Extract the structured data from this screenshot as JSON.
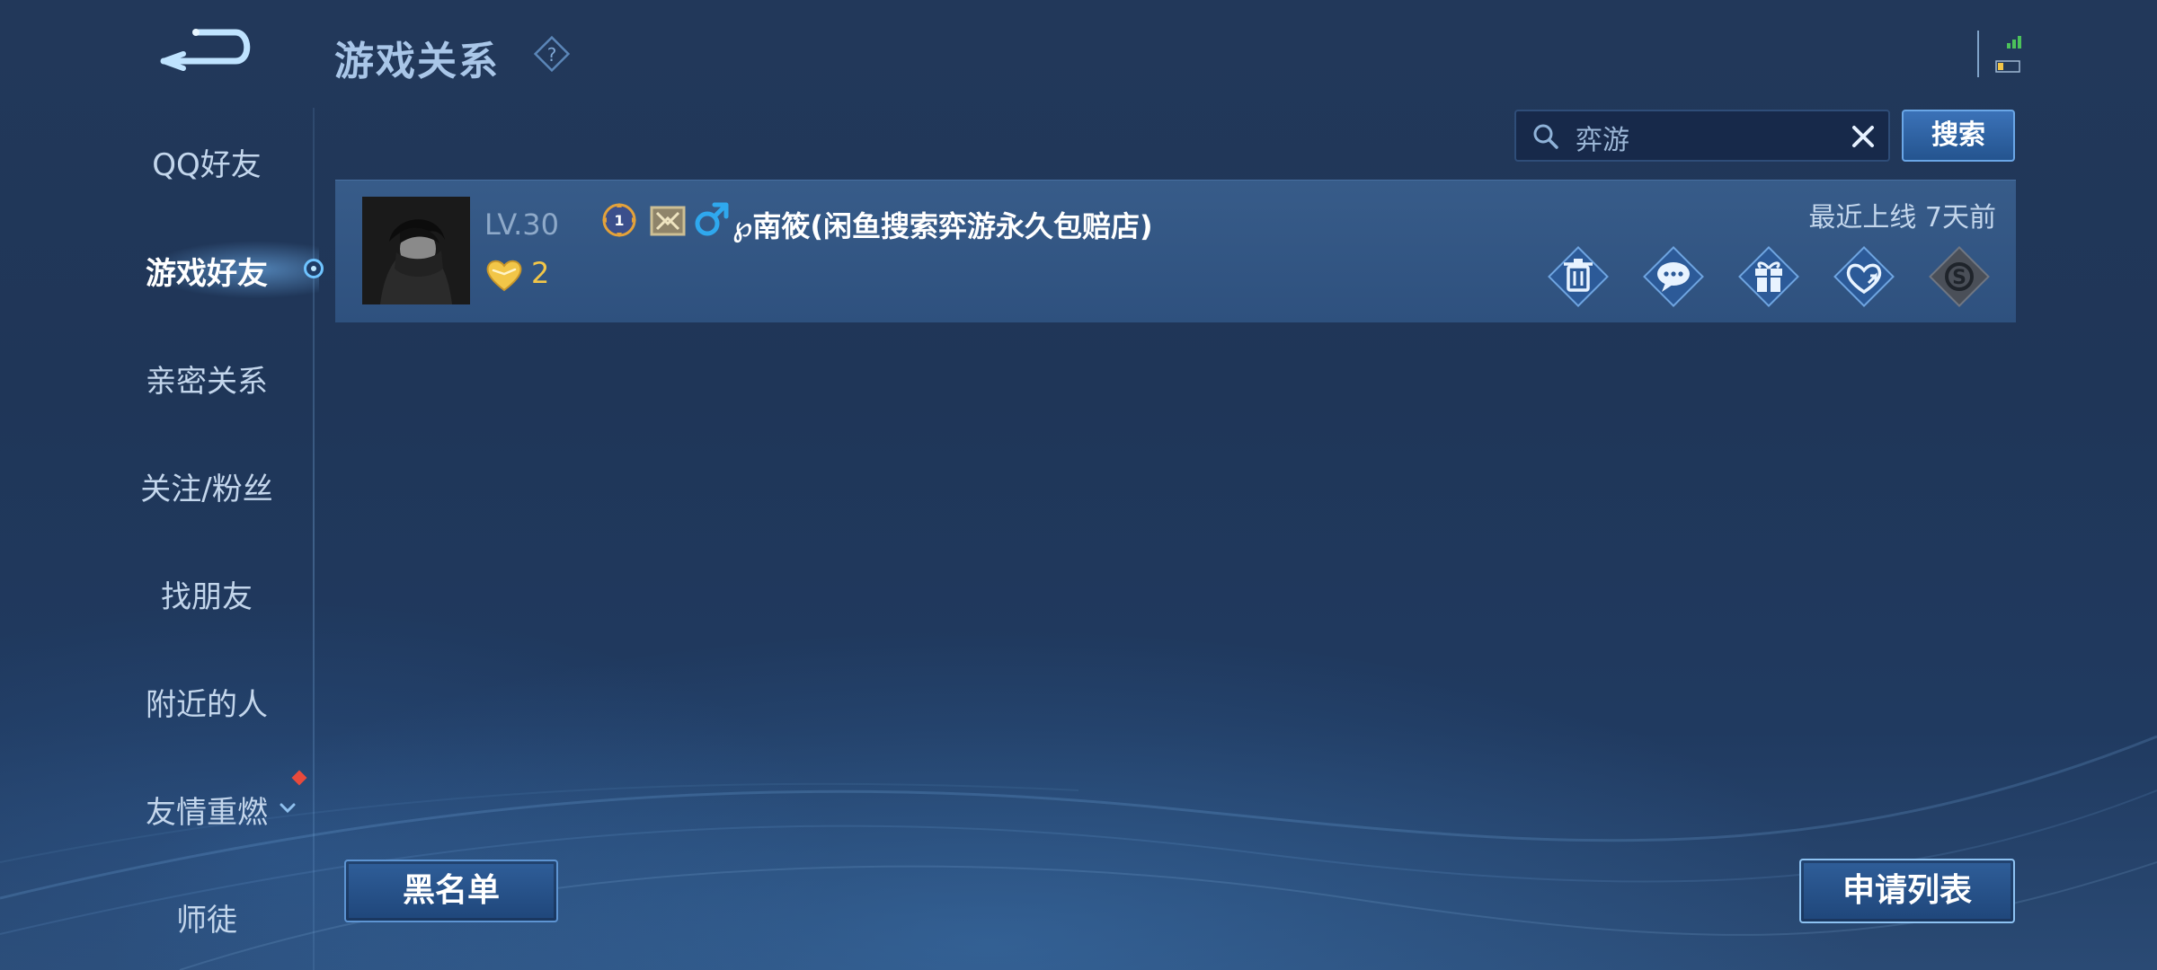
{
  "header": {
    "title": "游戏关系",
    "back_icon": "back-arrow-icon",
    "help_icon": "question-icon"
  },
  "sidebar": {
    "items": [
      {
        "label": "QQ好友"
      },
      {
        "label": "游戏好友",
        "active": true
      },
      {
        "label": "亲密关系"
      },
      {
        "label": "关注/粉丝"
      },
      {
        "label": "找朋友"
      },
      {
        "label": "附近的人"
      },
      {
        "label": "友情重燃",
        "has_notification": true,
        "expandable": true
      },
      {
        "label": "师徒"
      }
    ]
  },
  "search": {
    "value": "弈游",
    "button_label": "搜索"
  },
  "friends": [
    {
      "level": "LV.30",
      "intimacy": "2",
      "rank_badge": "1",
      "gender": "male",
      "nickname": "℘南筱(闲鱼搜索弈游永久包赔店)",
      "last_online": "最近上线  7天前",
      "actions": [
        "delete-icon",
        "chat-icon",
        "gift-icon",
        "intimacy-icon",
        "coin-icon"
      ]
    }
  ],
  "footer": {
    "blacklist_label": "黑名单",
    "requests_label": "申请列表"
  },
  "colors": {
    "background": "#22385a",
    "accent": "#6aa6e6",
    "highlight_text": "#ffffff",
    "heart": "#f2c648",
    "notification": "#e84a3c"
  }
}
